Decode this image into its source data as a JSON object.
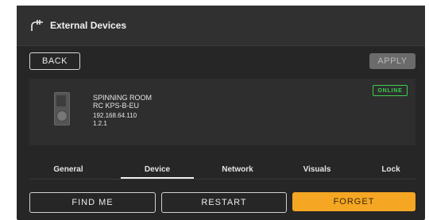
{
  "header": {
    "title": "External Devices",
    "icon": "device-plug-icon"
  },
  "toolbar": {
    "back_label": "BACK",
    "apply_label": "APPLY"
  },
  "device": {
    "name": "SPINNING ROOM",
    "model": "RC KPS-B-EU",
    "ip": "192.168.64.110",
    "version": "1.2.1",
    "status": "ONLINE"
  },
  "tabs": [
    {
      "label": "General",
      "active": false
    },
    {
      "label": "Device",
      "active": true
    },
    {
      "label": "Network",
      "active": false
    },
    {
      "label": "Visuals",
      "active": false
    },
    {
      "label": "Lock",
      "active": false
    }
  ],
  "actions": {
    "find_me": "FIND ME",
    "restart": "RESTART",
    "forget": "FORGET"
  },
  "colors": {
    "accent": "#f5a623",
    "online": "#3ccf4e",
    "background": "#262626"
  }
}
